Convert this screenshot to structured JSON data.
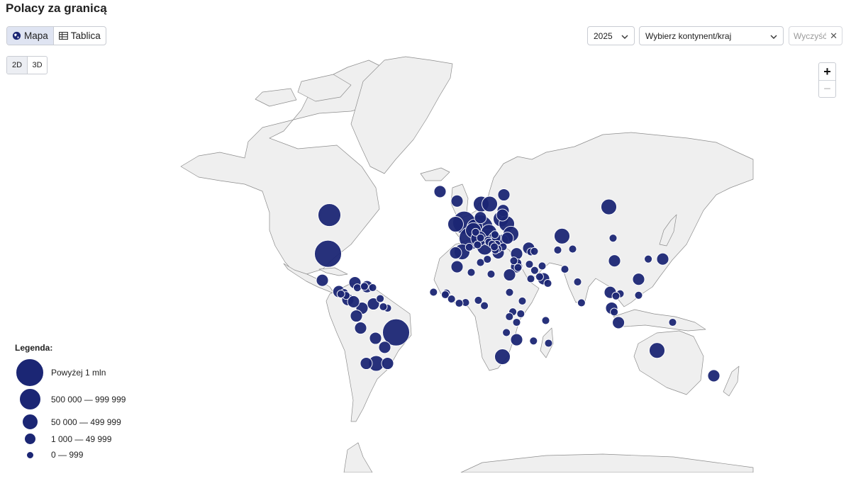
{
  "page_title": "Polacy za granicą",
  "view_toggle": {
    "map_label": "Mapa",
    "table_label": "Tablica",
    "active": "map"
  },
  "dimension_toggle": {
    "two_d_label": "2D",
    "three_d_label": "3D",
    "active": "2D"
  },
  "filters": {
    "year": "2025",
    "region_placeholder": "Wybierz kontynent/kraj",
    "clear_placeholder": "Wyczyść"
  },
  "zoom": {
    "in_label": "+",
    "out_label": "−"
  },
  "legend": {
    "title": "Legenda:",
    "items": [
      {
        "label": "Powyżej 1 mln",
        "size": "xl"
      },
      {
        "label": "500 000 — 999 999",
        "size": "l"
      },
      {
        "label": "50 000 — 499 999",
        "size": "m"
      },
      {
        "label": "1 000 — 49 999",
        "size": "s"
      },
      {
        "label": "0 — 999",
        "size": "xs"
      }
    ]
  },
  "colors": {
    "bubble": "#1b2674",
    "land": "#efefef",
    "border": "#8c8c8c",
    "active_toggle": "#dfe4f2"
  },
  "bubbles": [
    {
      "region": "Germany",
      "size": "xl",
      "lon": 9,
      "lat": 51.5
    },
    {
      "region": "USA",
      "size": "xl",
      "lon": -98,
      "lat": 39
    },
    {
      "region": "Brazil",
      "size": "xl",
      "lon": -50,
      "lat": -13
    },
    {
      "region": "United Kingdom",
      "size": "l",
      "lon": -2,
      "lat": 54
    },
    {
      "region": "Canada",
      "size": "l",
      "lon": -97,
      "lat": 57
    },
    {
      "region": "France",
      "size": "l",
      "lon": 2.5,
      "lat": 47
    },
    {
      "region": "Argentina",
      "size": "m",
      "lon": -64,
      "lat": -33
    },
    {
      "region": "Australia",
      "size": "m",
      "lon": 134,
      "lat": -25
    },
    {
      "region": "Russia",
      "size": "m",
      "lon": 100,
      "lat": 60
    },
    {
      "region": "Ireland",
      "size": "m",
      "lon": -8,
      "lat": 53.3
    },
    {
      "region": "Netherlands",
      "size": "m",
      "lon": 5.5,
      "lat": 52.2
    },
    {
      "region": "Belgium",
      "size": "m",
      "lon": 4.5,
      "lat": 50.6
    },
    {
      "region": "Lithuania",
      "size": "m",
      "lon": 24,
      "lat": 55.5
    },
    {
      "region": "Belarus",
      "size": "m",
      "lon": 28,
      "lat": 53.5
    },
    {
      "region": "Ukraine",
      "size": "m",
      "lon": 31,
      "lat": 49
    },
    {
      "region": "Norway",
      "size": "m",
      "lon": 10,
      "lat": 61
    },
    {
      "region": "Sweden",
      "size": "m",
      "lon": 16,
      "lat": 61
    },
    {
      "region": "Italy",
      "size": "m",
      "lon": 12.5,
      "lat": 42.5
    },
    {
      "region": "Spain",
      "size": "m",
      "lon": -3.5,
      "lat": 40
    },
    {
      "region": "Austria",
      "size": "m",
      "lon": 14.5,
      "lat": 47.5
    },
    {
      "region": "Czechia",
      "size": "m",
      "lon": 15.5,
      "lat": 49.8
    },
    {
      "region": "Switzerland",
      "size": "m",
      "lon": 8.2,
      "lat": 46.8
    },
    {
      "region": "Kazakhstan",
      "size": "m",
      "lon": 67,
      "lat": 48
    },
    {
      "region": "South Africa",
      "size": "m",
      "lon": 25,
      "lat": -29
    },
    {
      "region": "Chile",
      "size": "s",
      "lon": -71,
      "lat": -33
    },
    {
      "region": "Uruguay",
      "size": "s",
      "lon": -56,
      "lat": -33
    },
    {
      "region": "Mexico",
      "size": "s",
      "lon": -102,
      "lat": 23
    },
    {
      "region": "Venezuela",
      "size": "s",
      "lon": -66,
      "lat": 7
    },
    {
      "region": "Colombia",
      "size": "s",
      "lon": -74,
      "lat": 4
    },
    {
      "region": "Peru",
      "size": "s",
      "lon": -75,
      "lat": -10
    },
    {
      "region": "Ecuador",
      "size": "s",
      "lon": -78,
      "lat": -1.5
    },
    {
      "region": "Bolivia",
      "size": "s",
      "lon": -64.5,
      "lat": -17
    },
    {
      "region": "Paraguay",
      "size": "s",
      "lon": -58,
      "lat": -23
    },
    {
      "region": "Cuba",
      "size": "s",
      "lon": -79,
      "lat": 21.5
    },
    {
      "region": "Dominican Republic",
      "size": "s",
      "lon": -70.5,
      "lat": 18.8
    },
    {
      "region": "Guatemala",
      "size": "s",
      "lon": -90.3,
      "lat": 15.5
    },
    {
      "region": "Costa Rica",
      "size": "s",
      "lon": -84,
      "lat": 10
    },
    {
      "region": "Panama",
      "size": "s",
      "lon": -80,
      "lat": 8.5
    },
    {
      "region": "Iceland",
      "size": "s",
      "lon": -19,
      "lat": 65
    },
    {
      "region": "Finland",
      "size": "s",
      "lon": 26,
      "lat": 64
    },
    {
      "region": "Estonia",
      "size": "s",
      "lon": 25.5,
      "lat": 58.7
    },
    {
      "region": "Latvia",
      "size": "s",
      "lon": 25,
      "lat": 57
    },
    {
      "region": "Denmark",
      "size": "s",
      "lon": 9.5,
      "lat": 56
    },
    {
      "region": "Portugal",
      "size": "s",
      "lon": -8,
      "lat": 39.5
    },
    {
      "region": "Greece",
      "size": "s",
      "lon": 22,
      "lat": 39.5
    },
    {
      "region": "Turkey",
      "size": "s",
      "lon": 35,
      "lat": 39
    },
    {
      "region": "Georgia",
      "size": "s",
      "lon": 43.5,
      "lat": 42
    },
    {
      "region": "Romania",
      "size": "s",
      "lon": 25,
      "lat": 45.9
    },
    {
      "region": "Hungary",
      "size": "s",
      "lon": 19.5,
      "lat": 47.2
    },
    {
      "region": "Moldova",
      "size": "s",
      "lon": 28.5,
      "lat": 47
    },
    {
      "region": "Israel",
      "size": "s",
      "lon": 35,
      "lat": 31.5
    },
    {
      "region": "Egypt",
      "size": "s",
      "lon": 30,
      "lat": 26.5
    },
    {
      "region": "Morocco",
      "size": "s",
      "lon": -7,
      "lat": 31.5
    },
    {
      "region": "UAE",
      "size": "s",
      "lon": 54,
      "lat": 24
    },
    {
      "region": "China",
      "size": "s",
      "lon": 104,
      "lat": 35
    },
    {
      "region": "Japan",
      "size": "s",
      "lon": 138,
      "lat": 36
    },
    {
      "region": "Taiwan",
      "size": "s",
      "lon": 121,
      "lat": 23.7
    },
    {
      "region": "Thailand",
      "size": "s",
      "lon": 101,
      "lat": 15
    },
    {
      "region": "Malaysia",
      "size": "s",
      "lon": 102,
      "lat": 4
    },
    {
      "region": "Indonesia",
      "size": "s",
      "lon": 106.8,
      "lat": -6.2
    },
    {
      "region": "New Zealand",
      "size": "s",
      "lon": 174,
      "lat": -40
    },
    {
      "region": "Mozambique",
      "size": "s",
      "lon": 35,
      "lat": -18
    },
    {
      "region": "Faroe Islands",
      "size": "s",
      "lon": -7,
      "lat": 62
    },
    {
      "region": "Uzbekistan",
      "size": "xs",
      "lon": 64,
      "lat": 41
    },
    {
      "region": "Kyrgyzstan",
      "size": "xs",
      "lon": 74.5,
      "lat": 41.5
    },
    {
      "region": "Mongolia",
      "size": "xs",
      "lon": 103,
      "lat": 47
    },
    {
      "region": "Armenia",
      "size": "xs",
      "lon": 45,
      "lat": 40
    },
    {
      "region": "Azerbaijan",
      "size": "xs",
      "lon": 47.5,
      "lat": 40.3
    },
    {
      "region": "Lebanon",
      "size": "xs",
      "lon": 35.8,
      "lat": 33.9
    },
    {
      "region": "Cyprus",
      "size": "xs",
      "lon": 33,
      "lat": 35
    },
    {
      "region": "Jordan",
      "size": "xs",
      "lon": 36,
      "lat": 31
    },
    {
      "region": "Iraq",
      "size": "xs",
      "lon": 44,
      "lat": 33
    },
    {
      "region": "Iran",
      "size": "xs",
      "lon": 53,
      "lat": 32
    },
    {
      "region": "Saudi Arabia",
      "size": "xs",
      "lon": 45,
      "lat": 24
    },
    {
      "region": "Kuwait",
      "size": "xs",
      "lon": 47.7,
      "lat": 29.3
    },
    {
      "region": "Qatar",
      "size": "xs",
      "lon": 51.2,
      "lat": 25.3
    },
    {
      "region": "Oman",
      "size": "xs",
      "lon": 57,
      "lat": 21
    },
    {
      "region": "Pakistan",
      "size": "xs",
      "lon": 69,
      "lat": 30
    },
    {
      "region": "India",
      "size": "xs",
      "lon": 78,
      "lat": 22
    },
    {
      "region": "Sri Lanka",
      "size": "xs",
      "lon": 80.7,
      "lat": 7.8
    },
    {
      "region": "South Korea",
      "size": "xs",
      "lon": 127.8,
      "lat": 36
    },
    {
      "region": "Vietnam",
      "size": "xs",
      "lon": 108,
      "lat": 14
    },
    {
      "region": "Cambodia",
      "size": "xs",
      "lon": 105,
      "lat": 12.5
    },
    {
      "region": "Philippines",
      "size": "xs",
      "lon": 121,
      "lat": 13
    },
    {
      "region": "Singapore",
      "size": "xs",
      "lon": 103.8,
      "lat": 1.3
    },
    {
      "region": "Tunisia",
      "size": "xs",
      "lon": 9.5,
      "lat": 34
    },
    {
      "region": "Algeria",
      "size": "xs",
      "lon": 3,
      "lat": 28
    },
    {
      "region": "Libya",
      "size": "xs",
      "lon": 17,
      "lat": 27
    },
    {
      "region": "Sudan",
      "size": "xs",
      "lon": 30,
      "lat": 15
    },
    {
      "region": "Ethiopia",
      "size": "xs",
      "lon": 39,
      "lat": 9
    },
    {
      "region": "Kenya",
      "size": "xs",
      "lon": 37.9,
      "lat": 0
    },
    {
      "region": "Tanzania",
      "size": "xs",
      "lon": 35,
      "lat": -6
    },
    {
      "region": "Uganda",
      "size": "xs",
      "lon": 32.3,
      "lat": 1.4
    },
    {
      "region": "Rwanda",
      "size": "xs",
      "lon": 29.9,
      "lat": -2
    },
    {
      "region": "Nigeria",
      "size": "xs",
      "lon": 8,
      "lat": 9.5
    },
    {
      "region": "Ghana",
      "size": "xs",
      "lon": -1,
      "lat": 7.9
    },
    {
      "region": "Senegal",
      "size": "xs",
      "lon": -14.5,
      "lat": 14.5
    },
    {
      "region": "Gambia",
      "size": "xs",
      "lon": -15.3,
      "lat": 13.4
    },
    {
      "region": "Guinea",
      "size": "xs",
      "lon": -10.9,
      "lat": 10.4
    },
    {
      "region": "Ivory Coast",
      "size": "xs",
      "lon": -5.5,
      "lat": 7.5
    },
    {
      "region": "Cameroon",
      "size": "xs",
      "lon": 12.3,
      "lat": 5.7
    },
    {
      "region": "Cape Verde",
      "size": "xs",
      "lon": -23.6,
      "lat": 15.1
    },
    {
      "region": "Zambia",
      "size": "xs",
      "lon": 27.8,
      "lat": -13.1
    },
    {
      "region": "Madagascar",
      "size": "xs",
      "lon": 46.9,
      "lat": -18.8
    },
    {
      "region": "Seychelles",
      "size": "xs",
      "lon": 55.5,
      "lat": -4.7
    },
    {
      "region": "Mauritius",
      "size": "xs",
      "lon": 57.5,
      "lat": -20.3
    },
    {
      "region": "Honduras",
      "size": "xs",
      "lon": -86.5,
      "lat": 14.8
    },
    {
      "region": "Nicaragua",
      "size": "xs",
      "lon": -85.2,
      "lat": 12.8
    },
    {
      "region": "El Salvador",
      "size": "xs",
      "lon": -88.9,
      "lat": 13.8
    },
    {
      "region": "Jamaica",
      "size": "xs",
      "lon": -77.3,
      "lat": 18.1
    },
    {
      "region": "Haiti",
      "size": "xs",
      "lon": -72.3,
      "lat": 19
    },
    {
      "region": "Puerto Rico",
      "size": "xs",
      "lon": -66.5,
      "lat": 18.2
    },
    {
      "region": "Trinidad and Tobago",
      "size": "xs",
      "lon": -61.2,
      "lat": 10.7
    },
    {
      "region": "Suriname",
      "size": "xs",
      "lon": -56,
      "lat": 4
    },
    {
      "region": "Guyana",
      "size": "xs",
      "lon": -59,
      "lat": 5
    },
    {
      "region": "Papua New Guinea",
      "size": "xs",
      "lon": 145,
      "lat": -6
    },
    {
      "region": "Luxembourg",
      "size": "xs",
      "lon": 6.1,
      "lat": 49.8
    },
    {
      "region": "Slovakia",
      "size": "xs",
      "lon": 19.7,
      "lat": 48.7
    },
    {
      "region": "Slovenia",
      "size": "xs",
      "lon": 14.9,
      "lat": 46.1
    },
    {
      "region": "Croatia",
      "size": "xs",
      "lon": 15.5,
      "lat": 45.1
    },
    {
      "region": "Serbia",
      "size": "xs",
      "lon": 21,
      "lat": 44
    },
    {
      "region": "Bosnia and Herzegovina",
      "size": "xs",
      "lon": 17.7,
      "lat": 44
    },
    {
      "region": "Bulgaria",
      "size": "xs",
      "lon": 25.5,
      "lat": 42.7
    },
    {
      "region": "North Macedonia",
      "size": "xs",
      "lon": 21.7,
      "lat": 41.6
    },
    {
      "region": "Albania",
      "size": "xs",
      "lon": 20,
      "lat": 41
    },
    {
      "region": "Montenegro",
      "size": "xs",
      "lon": 19.3,
      "lat": 42.7
    },
    {
      "region": "Malta",
      "size": "xs",
      "lon": 14.4,
      "lat": 35.9
    },
    {
      "region": "Monaco",
      "size": "xs",
      "lon": 7.4,
      "lat": 43.7
    },
    {
      "region": "Andorra",
      "size": "xs",
      "lon": 1.6,
      "lat": 42.5
    },
    {
      "region": "Liechtenstein",
      "size": "xs",
      "lon": 9.55,
      "lat": 47.15
    }
  ]
}
